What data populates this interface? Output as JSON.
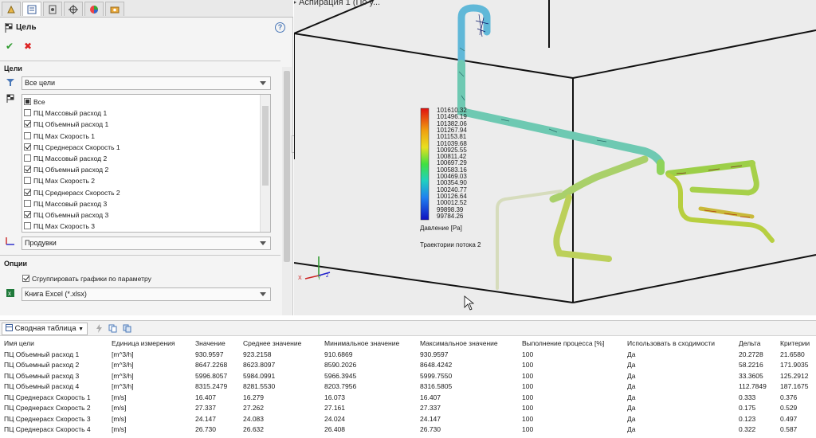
{
  "viewport": {
    "title": "Аспирация 1  (По у..."
  },
  "property_manager": {
    "title": "Цель",
    "help_label": "?",
    "ok_label": "✔",
    "cancel_label": "✖",
    "goals_group": {
      "header": "Цели",
      "filter_value": "Все цели",
      "items": [
        {
          "label": "Все",
          "state": "partial"
        },
        {
          "label": "ПЦ Массовый расход 1",
          "state": "unchecked"
        },
        {
          "label": "ПЦ Объемный расход 1",
          "state": "checked"
        },
        {
          "label": "ПЦ Max Скорость 1",
          "state": "unchecked"
        },
        {
          "label": "ПЦ Среднерасх Скорость 1",
          "state": "checked"
        },
        {
          "label": "ПЦ Массовый расход 2",
          "state": "unchecked"
        },
        {
          "label": "ПЦ Объемный расход 2",
          "state": "checked"
        },
        {
          "label": "ПЦ Max Скорость 2",
          "state": "unchecked"
        },
        {
          "label": "ПЦ Среднерасх Скорость 2",
          "state": "checked"
        },
        {
          "label": "ПЦ Массовый расход 3",
          "state": "unchecked"
        },
        {
          "label": "ПЦ Объемный расход 3",
          "state": "checked"
        },
        {
          "label": "ПЦ Max Скорость 3",
          "state": "unchecked"
        }
      ],
      "parameter_value": "Продувки"
    },
    "options_group": {
      "header": "Опции",
      "group_plots_label": "Сгруппировать графики по параметру",
      "group_plots_checked": true,
      "export_value": "Книга Excel (*.xlsx)"
    }
  },
  "legend": {
    "ticks": [
      "101610.32",
      "101496.19",
      "101382.06",
      "101267.94",
      "101153.81",
      "101039.68",
      "100925.55",
      "100811.42",
      "100697.29",
      "100583.16",
      "100469.03",
      "100354.90",
      "100240.77",
      "100126.64",
      "100012.52",
      "99898.39",
      "99784.26"
    ],
    "title": "Давление [Pa]",
    "caption": "Траектории потока 2"
  },
  "table": {
    "tab_label": "Сводная таблица",
    "columns": [
      "Имя цели",
      "Единица измерения",
      "Значение",
      "Среднее значение",
      "Минимальное значение",
      "Максимальное значение",
      "Выполнение процесса [%]",
      "Использовать в сходимости",
      "Дельта",
      "Критерии"
    ],
    "rows": [
      [
        "ПЦ Объемный расход 1",
        "[m^3/h]",
        "930.9597",
        "923.2158",
        "910.6869",
        "930.9597",
        "100",
        "Да",
        "20.2728",
        "21.6580"
      ],
      [
        "ПЦ Объемный расход 2",
        "[m^3/h]",
        "8647.2268",
        "8623.8097",
        "8590.2026",
        "8648.4242",
        "100",
        "Да",
        "58.2216",
        "171.9035"
      ],
      [
        "ПЦ Объемный расход 3",
        "[m^3/h]",
        "5996.8057",
        "5984.0991",
        "5966.3945",
        "5999.7550",
        "100",
        "Да",
        "33.3605",
        "125.2912"
      ],
      [
        "ПЦ Объемный расход 4",
        "[m^3/h]",
        "8315.2479",
        "8281.5530",
        "8203.7956",
        "8316.5805",
        "100",
        "Да",
        "112.7849",
        "187.1675"
      ],
      [
        "ПЦ Среднерасх Скорость 1",
        "[m/s]",
        "16.407",
        "16.279",
        "16.073",
        "16.407",
        "100",
        "Да",
        "0.333",
        "0.376"
      ],
      [
        "ПЦ Среднерасх Скорость 2",
        "[m/s]",
        "27.337",
        "27.262",
        "27.161",
        "27.337",
        "100",
        "Да",
        "0.175",
        "0.529"
      ],
      [
        "ПЦ Среднерасх Скорость 3",
        "[m/s]",
        "24.147",
        "24.083",
        "24.024",
        "24.147",
        "100",
        "Да",
        "0.123",
        "0.497"
      ],
      [
        "ПЦ Среднерасх Скорость 4",
        "[m/s]",
        "26.730",
        "26.632",
        "26.408",
        "26.730",
        "100",
        "Да",
        "0.322",
        "0.587"
      ]
    ]
  }
}
